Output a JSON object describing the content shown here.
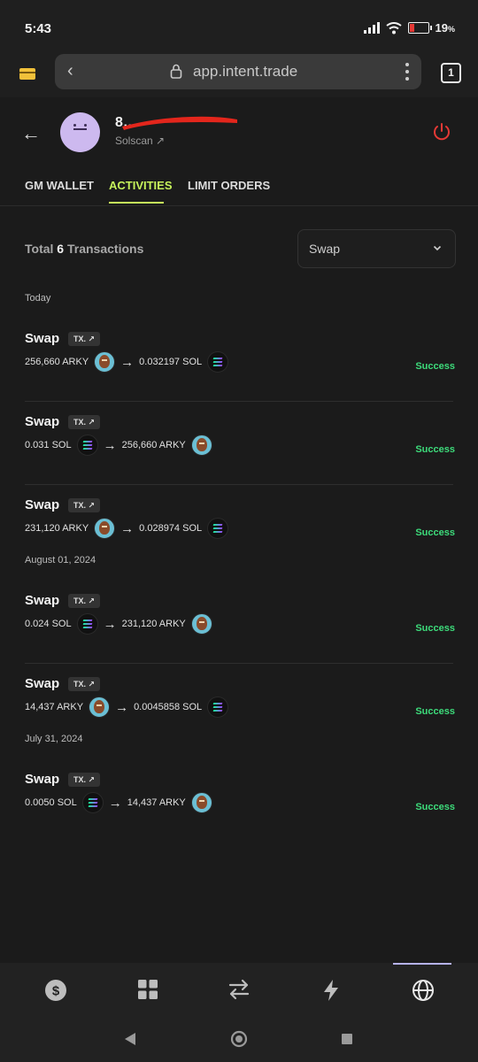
{
  "status_bar": {
    "time": "5:43",
    "battery": "19",
    "battery_unit": "%"
  },
  "browser": {
    "url": "app.intent.trade",
    "tab_count": "1"
  },
  "profile": {
    "name": "8…",
    "link": "Solscan"
  },
  "tabs": [
    {
      "label": "GM WALLET",
      "active": false
    },
    {
      "label": "ACTIVITIES",
      "active": true
    },
    {
      "label": "LIMIT ORDERS",
      "active": false
    }
  ],
  "summary": {
    "prefix": "Total",
    "count": "6",
    "suffix": "Transactions"
  },
  "filter": {
    "value": "Swap"
  },
  "dates": [
    "Today",
    "August 01, 2024",
    "July 31, 2024"
  ],
  "tx_badge": "TX.",
  "transactions": [
    {
      "title": "Swap",
      "from_amount": "256,660 ARKY",
      "from_icon": "arky-token-icon",
      "to_amount": "0.032197 SOL",
      "to_icon": "sol-token-icon",
      "status": "Success"
    },
    {
      "title": "Swap",
      "from_amount": "0.031 SOL",
      "from_icon": "sol-token-icon",
      "to_amount": "256,660 ARKY",
      "to_icon": "arky-token-icon",
      "status": "Success"
    },
    {
      "title": "Swap",
      "from_amount": "231,120 ARKY",
      "from_icon": "arky-token-icon",
      "to_amount": "0.028974 SOL",
      "to_icon": "sol-token-icon",
      "status": "Success"
    },
    {
      "title": "Swap",
      "from_amount": "0.024 SOL",
      "from_icon": "sol-token-icon",
      "to_amount": "231,120 ARKY",
      "to_icon": "arky-token-icon",
      "status": "Success"
    },
    {
      "title": "Swap",
      "from_amount": "14,437 ARKY",
      "from_icon": "arky-token-icon",
      "to_amount": "0.0045858 SOL",
      "to_icon": "sol-token-icon",
      "status": "Success"
    },
    {
      "title": "Swap",
      "from_amount": "0.0050 SOL",
      "from_icon": "sol-token-icon",
      "to_amount": "14,437 ARKY",
      "to_icon": "arky-token-icon",
      "status": "Success"
    }
  ],
  "bottom_nav": [
    "dollar-icon",
    "grid-icon",
    "swap-arrows-icon",
    "lightning-icon",
    "globe-icon"
  ],
  "colors": {
    "accent": "#c6f25b",
    "success": "#3ddc7b",
    "power": "#e53935",
    "nav_indicator": "#b6b2f0"
  }
}
